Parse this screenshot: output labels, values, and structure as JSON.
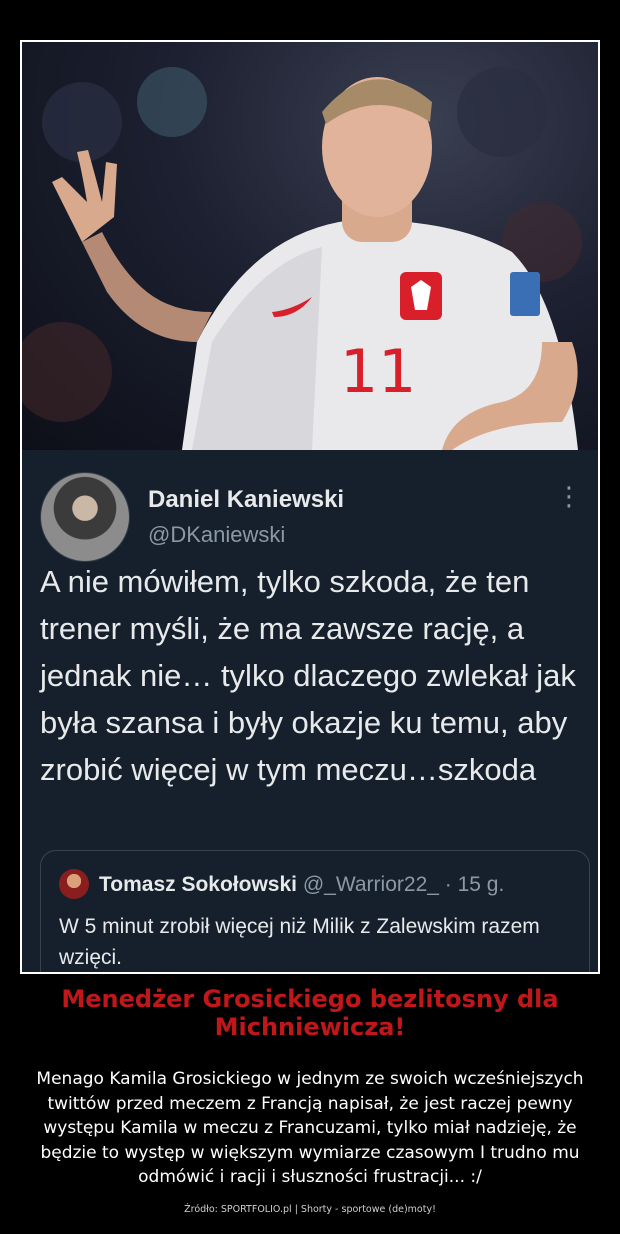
{
  "tweet": {
    "author": "Daniel Kaniewski",
    "handle": "@DKaniewski",
    "text": "A nie mówiłem, tylko szkoda, że ten trener myśli, że ma zawsze rację, a jednak nie… tylko dlaczego zwlekał jak była szansa i były okazje ku temu, aby zrobić więcej w tym meczu…szkoda",
    "more_icon": "⋮",
    "quoted": {
      "author": "Tomasz Sokołowski",
      "meta": "@_Warrior22_ · 15 g.",
      "text": "W 5 minut zrobił więcej niż Milik z Zalewskim razem wzięci."
    }
  },
  "photo": {
    "jersey_number": "11"
  },
  "headline": "Menedżer Grosickiego bezlitosny dla Michniewicza!",
  "description": "Menago Kamila Grosickiego w jednym ze swoich wcześniejszych twittów przed meczem z Francją napisał, że jest raczej pewny występu Kamila w meczu z Francuzami, tylko miał nadzieję, że będzie to występ w większym wymiarze czasowym I trudno mu odmówić i racji i słuszności frustracji... :/",
  "source": "Źródło: SPORTFOLIO.pl | Shorty - sportowe (de)moty!",
  "colors": {
    "headline": "#c0171a",
    "tweet_bg": "#16202c",
    "page_bg": "#000000"
  }
}
